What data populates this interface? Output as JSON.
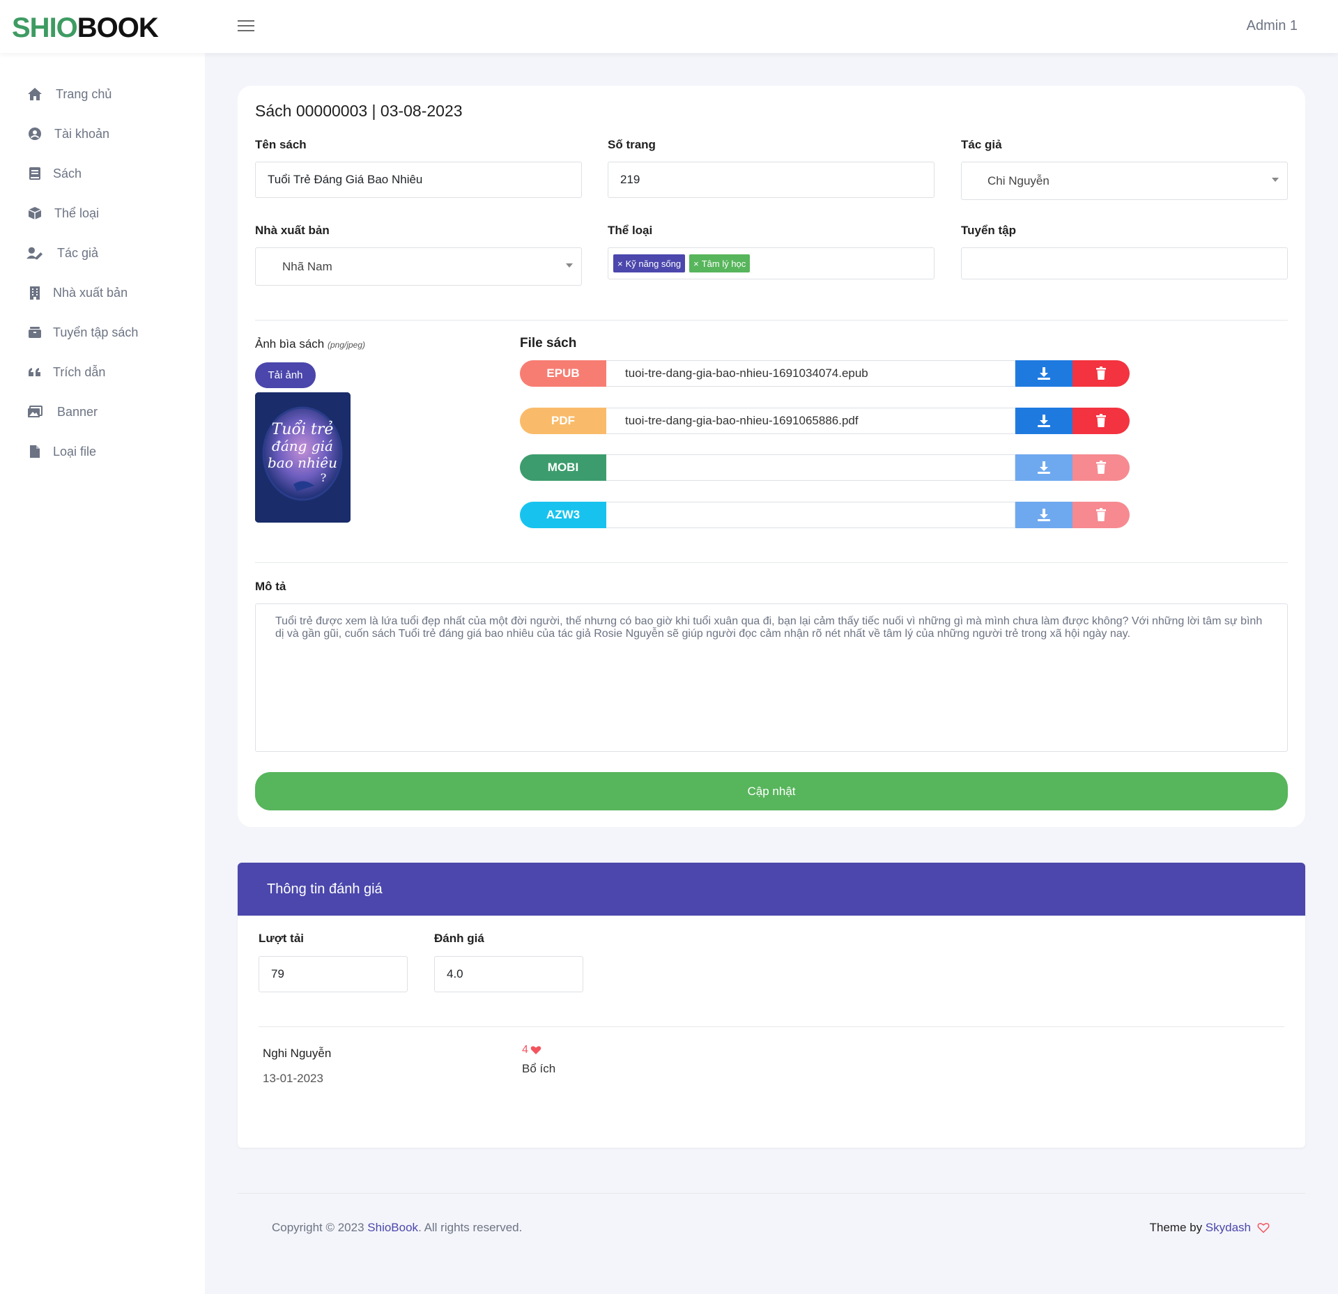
{
  "header": {
    "logo_part1": "SHIO",
    "logo_part2": "BOOK",
    "user": "Admin 1"
  },
  "sidebar": {
    "items": [
      {
        "label": "Trang chủ",
        "icon": "home-icon"
      },
      {
        "label": "Tài khoản",
        "icon": "account-icon"
      },
      {
        "label": "Sách",
        "icon": "book-icon"
      },
      {
        "label": "Thể loại",
        "icon": "box-icon"
      },
      {
        "label": "Tác giả",
        "icon": "author-icon"
      },
      {
        "label": "Nhà xuất bản",
        "icon": "building-icon"
      },
      {
        "label": "Tuyển tập sách",
        "icon": "collection-icon"
      },
      {
        "label": "Trích dẫn",
        "icon": "quote-icon"
      },
      {
        "label": "Banner",
        "icon": "image-icon"
      },
      {
        "label": "Loại file",
        "icon": "file-icon"
      }
    ]
  },
  "book": {
    "title": "Sách 00000003 | 03-08-2023",
    "name_label": "Tên sách",
    "name_value": "Tuổi Trẻ Đáng Giá Bao Nhiêu",
    "pages_label": "Số trang",
    "pages_value": "219",
    "author_label": "Tác giả",
    "author_value": "Chi Nguyễn",
    "publisher_label": "Nhà xuất bản",
    "publisher_value": "Nhã Nam",
    "category_label": "Thể loại",
    "categories": [
      "Kỹ năng sống",
      "Tâm lý học"
    ],
    "collection_label": "Tuyển tập",
    "collection_value": "",
    "cover_label": "Ảnh bìa sách",
    "cover_hint": "(png/jpeg)",
    "upload_label": "Tải ảnh",
    "cover_text_1": "Tuổi trẻ",
    "cover_text_2": "đáng giá",
    "cover_text_3": "bao nhiêu",
    "cover_text_4": "?",
    "files_label": "File sách",
    "files": [
      {
        "type": "EPUB",
        "name": "tuoi-tre-dang-gia-bao-nhieu-1691034074.epub",
        "color": "#f77d73",
        "enabled": true
      },
      {
        "type": "PDF",
        "name": "tuoi-tre-dang-gia-bao-nhieu-1691065886.pdf",
        "color": "#f9bb6a",
        "enabled": true
      },
      {
        "type": "MOBI",
        "name": "",
        "color": "#3c9c6d",
        "enabled": false
      },
      {
        "type": "AZW3",
        "name": "",
        "color": "#17c3ee",
        "enabled": false
      }
    ],
    "desc_label": "Mô tả",
    "desc_value": "Tuổi trẻ được xem là lứa tuổi đẹp nhất của một đời người, thế nhưng có bao giờ khi tuổi xuân qua đi, bạn lại cảm thấy tiếc nuối vì những gì mà mình chưa làm được không? Với những lời tâm sự bình dị và gần gũi, cuốn sách Tuổi trẻ đáng giá bao nhiêu của tác giả Rosie Nguyễn sẽ giúp người đọc cảm nhận rõ nét nhất về tâm lý của những người trẻ trong xã hội ngày nay.",
    "update_label": "Cập nhật"
  },
  "reviews": {
    "header": "Thông tin đánh giá",
    "downloads_label": "Lượt tải",
    "downloads_value": "79",
    "rating_label": "Đánh giá",
    "rating_value": "4.0",
    "items": [
      {
        "user": "Nghi Nguyễn",
        "date": "13-01-2023",
        "score": "4",
        "comment": "Bổ ích"
      }
    ]
  },
  "footer": {
    "copyright_prefix": "Copyright © 2023 ",
    "brand": "ShioBook",
    "copyright_suffix": ". All rights reserved.",
    "theme_prefix": "Theme by ",
    "theme_link": "Skydash"
  },
  "colors": {
    "brand_green": "#3e9b62",
    "primary": "#4b47ac",
    "success": "#57b55b",
    "download": "#1f7ae0",
    "delete": "#f3333f"
  }
}
